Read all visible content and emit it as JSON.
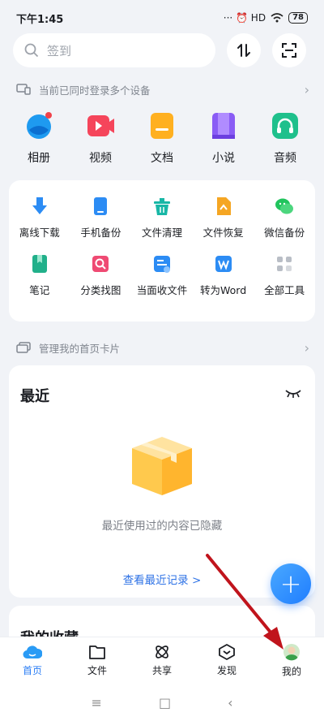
{
  "status": {
    "time": "下午1:45",
    "indicators": "··· ⏰ HD",
    "battery": "78"
  },
  "search": {
    "placeholder": "签到"
  },
  "devices_hint": {
    "text": "当前已同时登录多个设备"
  },
  "quick": [
    {
      "label": "相册",
      "icon": "album-icon",
      "color": "#1e9af0"
    },
    {
      "label": "视频",
      "icon": "video-icon",
      "color": "#f5455b"
    },
    {
      "label": "文档",
      "icon": "document-icon",
      "color": "#ffb020"
    },
    {
      "label": "小说",
      "icon": "novel-icon",
      "color": "#8a5cf5"
    },
    {
      "label": "音频",
      "icon": "audio-icon",
      "color": "#1fc08c"
    }
  ],
  "tools": [
    {
      "label": "离线下载",
      "icon": "offline-download-icon",
      "color": "#2c8cf4"
    },
    {
      "label": "手机备份",
      "icon": "phone-backup-icon",
      "color": "#2c8cf4"
    },
    {
      "label": "文件清理",
      "icon": "file-clean-icon",
      "color": "#18b7a6"
    },
    {
      "label": "文件恢复",
      "icon": "file-restore-icon",
      "color": "#f5a623"
    },
    {
      "label": "微信备份",
      "icon": "wechat-backup-icon",
      "color": "#21c45d"
    },
    {
      "label": "笔记",
      "icon": "note-icon",
      "color": "#21b08a"
    },
    {
      "label": "分类找图",
      "icon": "find-image-icon",
      "color": "#ef4a73"
    },
    {
      "label": "当面收文件",
      "icon": "receive-file-icon",
      "color": "#2c8cf4"
    },
    {
      "label": "转为Word",
      "icon": "word-convert-icon",
      "color": "#2c8cf4"
    },
    {
      "label": "全部工具",
      "icon": "all-tools-icon",
      "color": "#b9bec6"
    }
  ],
  "manage_hint": {
    "text": "管理我的首页卡片"
  },
  "recent": {
    "title": "最近",
    "hidden_text": "最近使用过的内容已隐藏",
    "view_link": "查看最近记录 >"
  },
  "favorites": {
    "title": "我的收藏"
  },
  "tabs": [
    {
      "label": "首页",
      "icon": "home-cloud-icon",
      "active": true
    },
    {
      "label": "文件",
      "icon": "folder-icon",
      "active": false
    },
    {
      "label": "共享",
      "icon": "share-atom-icon",
      "active": false
    },
    {
      "label": "发现",
      "icon": "discover-icon",
      "active": false
    },
    {
      "label": "我的",
      "icon": "avatar-icon",
      "active": false
    }
  ],
  "nav": {
    "menu": "≡",
    "home": "□",
    "back": "‹"
  },
  "colors": {
    "accent": "#2a7df5",
    "annotation_arrow": "#c0141c"
  }
}
